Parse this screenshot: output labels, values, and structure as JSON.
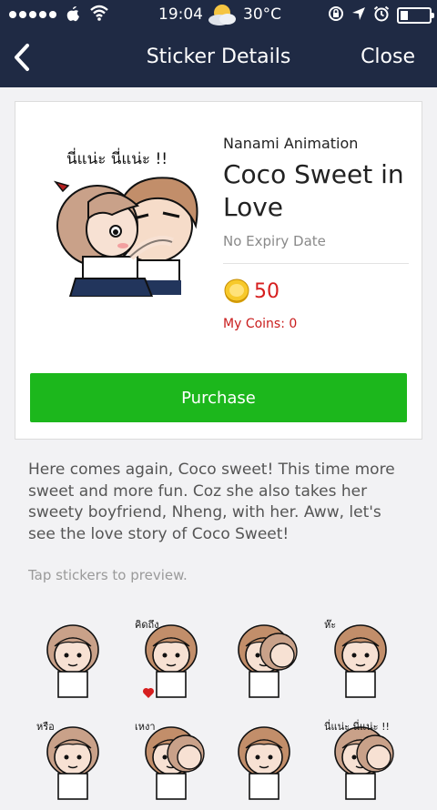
{
  "status_bar": {
    "time": "19:04",
    "temperature": "30°C",
    "signal_bars": 5,
    "battery_level": 0.3,
    "icons": [
      "signal-dots-icon",
      "apple-icon",
      "wifi-icon",
      "weather-icon",
      "rotation-lock-icon",
      "location-icon",
      "alarm-icon",
      "battery-icon"
    ]
  },
  "nav": {
    "title": "Sticker Details",
    "close_label": "Close",
    "back_icon": "chevron-left-icon"
  },
  "product": {
    "author": "Nanami Animation",
    "name": "Coco Sweet in Love",
    "expiry": "No Expiry Date",
    "price": "50",
    "my_coins": "My Coins: 0",
    "purchase_label": "Purchase",
    "thumbnail_caption": "นี่แน่ะ นี่แน่ะ !!"
  },
  "description": "Here comes again, Coco sweet! This time more sweet and more fun. Coz she also takes her sweety boyfriend, Nheng, with her. Aww, let's see the love story of Coco Sweet!",
  "preview_hint": "Tap stickers to preview.",
  "stickers": [
    {
      "name": "sticker-girl-smile"
    },
    {
      "name": "sticker-boy-thinking",
      "caption": "คิดถึง"
    },
    {
      "name": "sticker-couple-hug"
    },
    {
      "name": "sticker-boy-confused",
      "caption": "ห๊ะ"
    },
    {
      "name": "sticker-girl-shy",
      "caption": "หรือ"
    },
    {
      "name": "sticker-couple-sad",
      "caption": "เหงา"
    },
    {
      "name": "sticker-boy-hands"
    },
    {
      "name": "sticker-couple-kiss",
      "caption": "นี่แน่ะ นี่แน่ะ !!"
    }
  ],
  "colors": {
    "navbar": "#1f2a44",
    "purchase": "#1cb71c",
    "price": "#d61f1f",
    "background": "#f2f2f4"
  }
}
